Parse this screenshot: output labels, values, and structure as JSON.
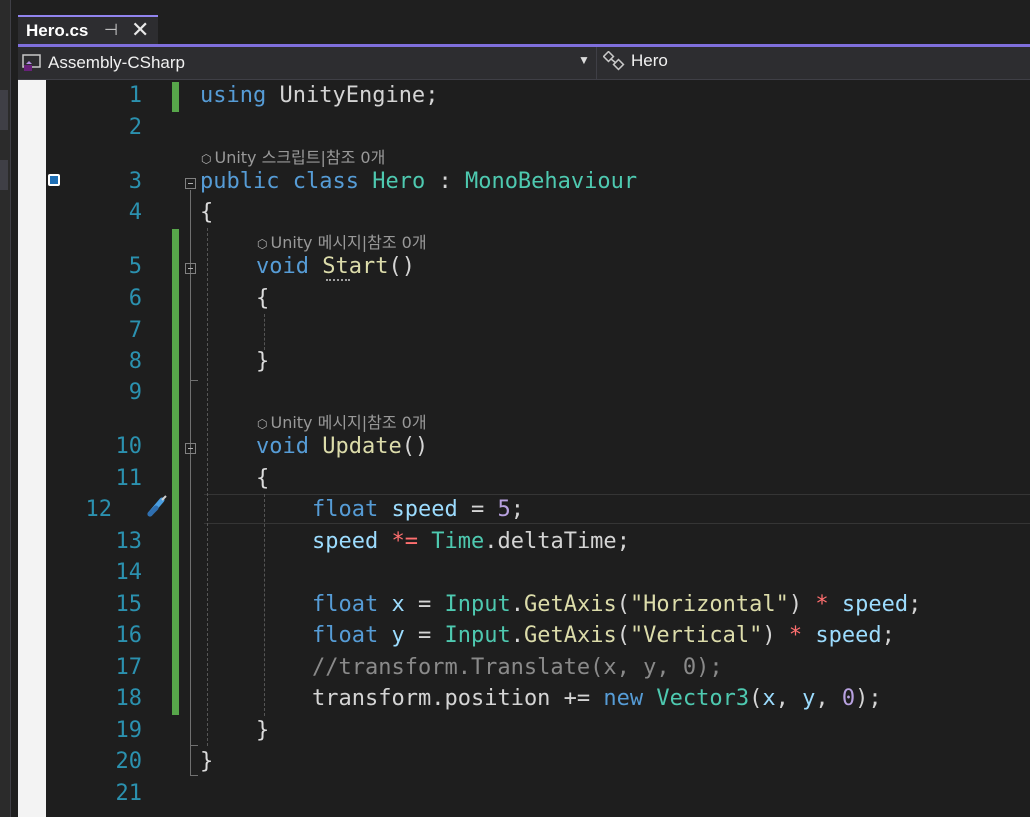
{
  "tab": {
    "title": "Hero.cs",
    "pin_icon": "pin-icon",
    "close_icon": "close-icon"
  },
  "navbar": {
    "project": "Assembly-CSharp",
    "class": "Hero"
  },
  "lens": {
    "script_refs": "Unity 스크립트|참조 0개",
    "message_refs_start": "Unity 메시지|참조 0개",
    "message_refs_update": "Unity 메시지|참조 0개"
  },
  "line_numbers": [
    "1",
    "2",
    "3",
    "4",
    "5",
    "6",
    "7",
    "8",
    "9",
    "10",
    "11",
    "12",
    "13",
    "14",
    "15",
    "16",
    "17",
    "18",
    "19",
    "20",
    "21"
  ],
  "code": {
    "l1": [
      "using",
      " ",
      "UnityEngine",
      ";"
    ],
    "l3": [
      "public",
      " ",
      "class",
      " ",
      "Hero",
      " : ",
      "MonoBehaviour"
    ],
    "l4": "{",
    "l5": [
      "void",
      " ",
      "Start",
      "()"
    ],
    "l6": "{",
    "l8": "}",
    "l10": [
      "void",
      " ",
      "Update",
      "()"
    ],
    "l11": "{",
    "l12": [
      "float",
      " ",
      "speed",
      " ",
      "=",
      " ",
      "5",
      ";"
    ],
    "l13": [
      "speed",
      " ",
      "*=",
      " ",
      "Time",
      ".",
      "deltaTime",
      ";"
    ],
    "l15": [
      "float",
      " ",
      "x",
      " ",
      "=",
      " ",
      "Input",
      ".",
      "GetAxis",
      "(",
      "\"Horizontal\"",
      ") ",
      "*",
      " ",
      "speed",
      ";"
    ],
    "l16": [
      "float",
      " ",
      "y",
      " ",
      "=",
      " ",
      "Input",
      ".",
      "GetAxis",
      "(",
      "\"Vertical\"",
      ") ",
      "*",
      " ",
      "speed",
      ";"
    ],
    "l17": "//transform.Translate(x, y, 0);",
    "l18": [
      "transform",
      ".",
      "position",
      " += ",
      "new",
      " ",
      "Vector3",
      "(",
      "x",
      ", ",
      "y",
      ", ",
      "0",
      ");"
    ],
    "l19": "}",
    "l20": "}"
  },
  "colors": {
    "accent": "#7f6fdc",
    "keyword": "#569cd6",
    "type": "#4ec9b0",
    "method": "#dcdcaa",
    "string": "#ce9178",
    "line_number": "#2b91af",
    "change_bar": "#57a64a"
  }
}
